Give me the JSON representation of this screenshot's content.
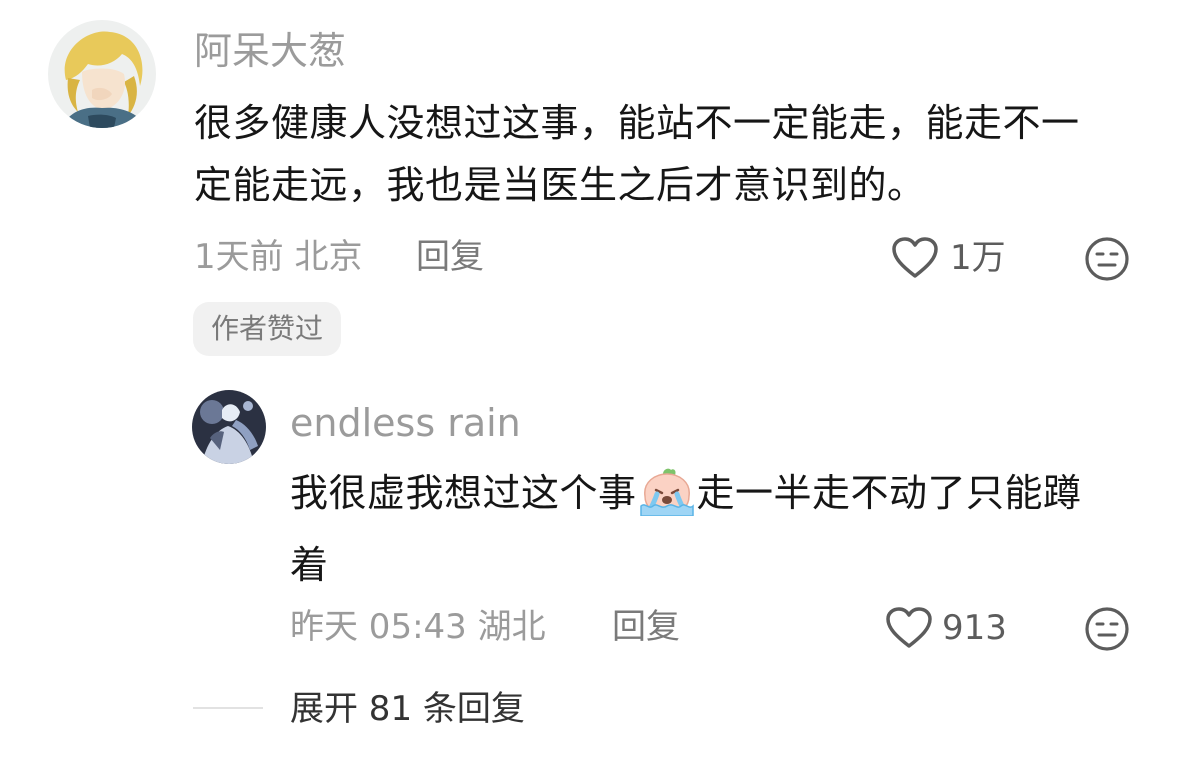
{
  "comment": {
    "username": "阿呆大葱",
    "text": "很多健康人没想过这事，能站不一定能走，能走不一定能走远，我也是当医生之后才意识到的。",
    "meta": "1天前 北京",
    "reply_label": "回复",
    "like_count": "1万",
    "author_liked_badge": "作者赞过"
  },
  "reply": {
    "username": "endless rain",
    "text_before_emoji": "我很虚我想过这个事",
    "emoji": "crying-peach-emoji",
    "text_after_emoji": "走一半走不动了只能蹲着",
    "meta": "昨天 05:43 湖北",
    "reply_label": "回复",
    "like_count": "913"
  },
  "expand_replies": {
    "label": "展开 81 条回复"
  },
  "icons": {
    "like": "heart-outline-icon",
    "dislike": "meh-face-icon"
  },
  "colors": {
    "username": "#9b9b9b",
    "text": "#161616",
    "meta": "#9b9b9b",
    "badge_bg": "#f1f1f1"
  }
}
